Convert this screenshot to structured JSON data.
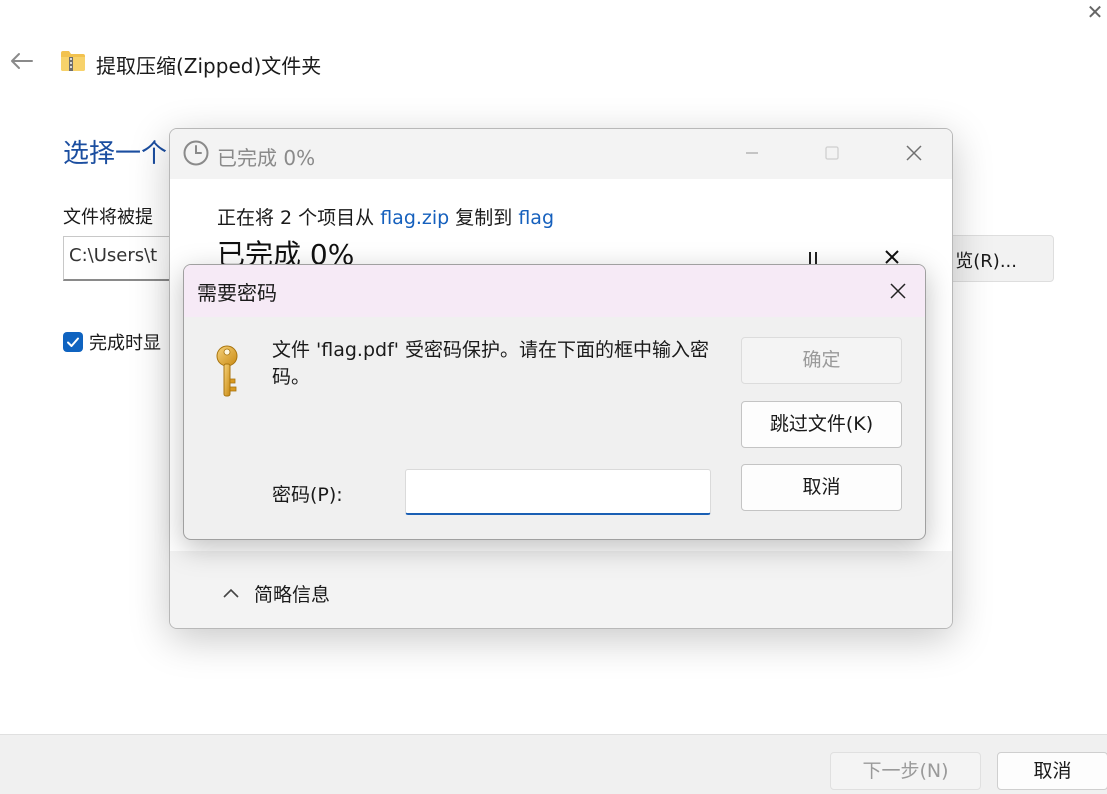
{
  "wizard": {
    "title": "提取压缩(Zipped)文件夹",
    "heading": "选择一个",
    "dest_label": "文件将被提",
    "path_value": "C:\\Users\\t",
    "browse_label": "览(R)...",
    "show_when_done_label": "完成时显",
    "show_when_done_checked": true,
    "next_label": "下一步(N)",
    "cancel_label": "取消"
  },
  "progress": {
    "title": "已完成 0%",
    "copy_prefix": "正在将 2 个项目从 ",
    "source": "flag.zip",
    "copy_middle": " 复制到 ",
    "destination": "flag",
    "percent_text": "已完成 0%",
    "details_label": "简略信息",
    "percent_value": 0
  },
  "password_dialog": {
    "title": "需要密码",
    "message": "文件 'flag.pdf' 受密码保护。请在下面的框中输入密码。",
    "ok_label": "确定",
    "skip_label": "跳过文件(K)",
    "cancel_label": "取消",
    "password_label": "密码(P):",
    "password_value": ""
  },
  "colors": {
    "accent": "#1560bd",
    "heading": "#1b4ea0",
    "password_titlebar": "#f6eaf6",
    "disabled_text": "#9a9a9a"
  },
  "icons": {
    "wizard_back": "arrow-left-icon",
    "wizard_folder": "zipped-folder-icon",
    "progress": "clock-icon",
    "password": "key-icon"
  }
}
